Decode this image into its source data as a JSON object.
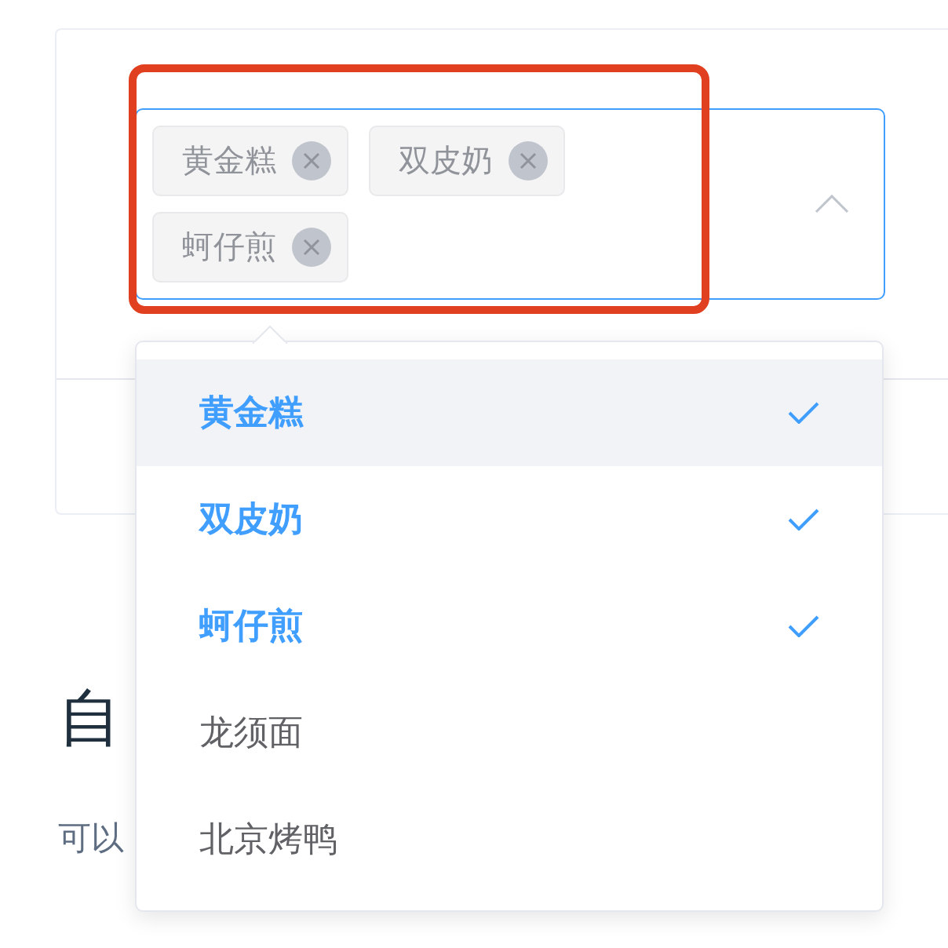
{
  "select": {
    "expanded": true,
    "tags": [
      {
        "label": "黄金糕"
      },
      {
        "label": "双皮奶"
      },
      {
        "label": "蚵仔煎"
      }
    ]
  },
  "dropdown": {
    "options": [
      {
        "label": "黄金糕",
        "selected": true,
        "hovered": true
      },
      {
        "label": "双皮奶",
        "selected": true,
        "hovered": false
      },
      {
        "label": "蚵仔煎",
        "selected": true,
        "hovered": false
      },
      {
        "label": "龙须面",
        "selected": false,
        "hovered": false
      },
      {
        "label": "北京烤鸭",
        "selected": false,
        "hovered": false
      }
    ]
  },
  "heading": "自",
  "paragraph": "可以"
}
